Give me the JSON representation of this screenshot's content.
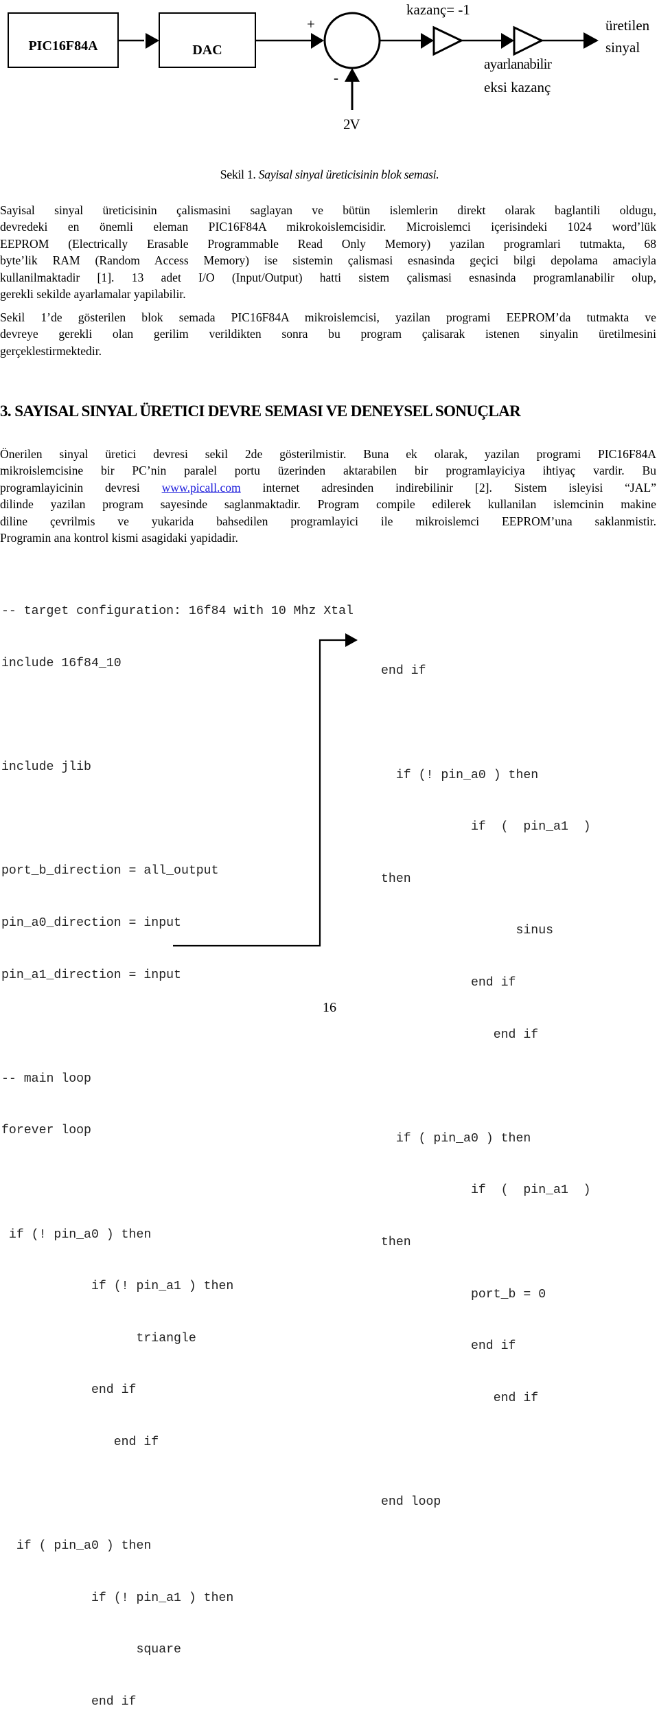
{
  "diagram": {
    "blocks": [
      {
        "label": "PIC16F84A"
      },
      {
        "label": "DAC"
      }
    ],
    "summer": {
      "plus_sign": "+",
      "minus_sign": "-",
      "reference_label": "2V"
    },
    "gain1_label": "kazanç= -1",
    "gain2_label_lines": [
      "ayarlanabilir",
      "eksi kazanç"
    ],
    "output_label_lines": [
      "üretilen",
      "sinyal"
    ]
  },
  "caption": {
    "prefix": "Sekil 1.",
    "title": "Sayisal sinyal üreticisinin blok semasi."
  },
  "paragraph1": {
    "lines": [
      "Sayisal sinyal üreticisinin çalismasini saglayan ve bütün islemlerin direkt olarak baglantili oldugu,",
      "devredeki en önemli eleman PIC16F84A mikrokoislemcisidir. Microislemci içerisindeki 1024 word’lük",
      "EEPROM (Electrically Erasable Programmable Read Only Memory) yazilan programlari tutmakta, 68",
      "byte’lik RAM (Random Access Memory) ise sistemin çalismasi esnasinda geçici bilgi depolama amaciyla",
      "kullanilmaktadir [1]. 13 adet I/O (Input/Output) hatti sistem çalismasi esnasinda programlanabilir olup,",
      "gerekli sekilde ayarlamalar yapilabilir."
    ]
  },
  "paragraph2": {
    "lines": [
      "Sekil 1’de gösterilen blok semada PIC16F84A mikroislemcisi, yazilan programi EEPROM’da tutmakta ve",
      "devreye gerekli olan gerilim verildikten sonra bu program çalisarak istenen sinyalin üretilmesini",
      "gerçeklestirmektedir."
    ]
  },
  "section_heading": "3. SAYISAL SINYAL ÜRETICI DEVRE SEMASI VE DENEYSEL SONUÇLAR",
  "paragraph3": {
    "line1": "Önerilen sinyal üretici devresi sekil 2de gösterilmistir. Buna ek olarak, yazilan programi PIC16F84A",
    "line2": "mikroislemcisine bir PC’nin paralel portu üzerinden aktarabilen bir programlayiciya ihtiyaç vardir. Bu",
    "line3_before_link": "programlayicinin devresi ",
    "line3_link": "www.picall.com",
    "line3_after_link": " internet adresinden indirebilinir [2]. Sistem isleyisi “JAL”",
    "line4": "dilinde yazilan program sayesinde saglanmaktadir. Program compile edilerek kullanilan islemcinin makine",
    "line5": "diline çevrilmis ve yukarida bahsedilen programlayici ile mikroislemci EEPROM’una saklanmistir.",
    "line6": "Programin ana kontrol kismi asagidaki yapidadir."
  },
  "code_left": {
    "header": [
      "-- target configuration: 16f84 with 10 Mhz Xtal",
      "include 16f84_10",
      "",
      "include jlib",
      "",
      "port_b_direction = all_output",
      "pin_a0_direction = input",
      "pin_a1_direction = input",
      "",
      "-- main loop",
      "forever loop",
      "",
      " if (! pin_a0 ) then",
      "            if (! pin_a1 ) then",
      "                  triangle",
      "            end if",
      "               end if",
      "",
      "  if ( pin_a0 ) then",
      "            if (! pin_a1 ) then",
      "                  square",
      "            end if"
    ]
  },
  "code_right": {
    "lines": [
      "end if",
      "",
      "  if (! pin_a0 ) then",
      "            if  (  pin_a1  )",
      "then",
      "                  sinus",
      "            end if",
      "               end if",
      "",
      "  if ( pin_a0 ) then",
      "            if  (  pin_a1  )",
      "then",
      "            port_b = 0",
      "            end if",
      "               end if",
      "",
      "end loop"
    ]
  },
  "page_number": "16"
}
